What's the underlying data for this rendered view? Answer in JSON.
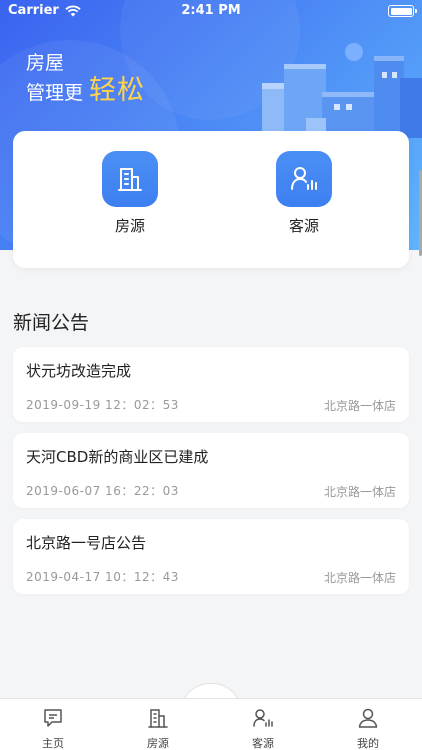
{
  "status_bar": {
    "carrier": "Carrier",
    "time": "2:41 PM"
  },
  "banner": {
    "line1": "房屋",
    "line2": "管理更",
    "accent": "轻松",
    "accent_color": "#ffd34a"
  },
  "quick_actions": [
    {
      "label": "房源",
      "icon": "building-icon"
    },
    {
      "label": "客源",
      "icon": "customer-chart-icon"
    }
  ],
  "news": {
    "title": "新闻公告",
    "items": [
      {
        "title": "状元坊改造完成",
        "time": "2019-09-19 12：02：53",
        "store": "北京路一体店"
      },
      {
        "title": "天河CBD新的商业区已建成",
        "time": "2019-06-07 16：22：03",
        "store": "北京路一体店"
      },
      {
        "title": "北京路一号店公告",
        "time": "2019-04-17 10：12：43",
        "store": "北京路一体店"
      }
    ]
  },
  "tabbar": [
    {
      "label": "主页",
      "icon": "message-icon"
    },
    {
      "label": "房源",
      "icon": "building-icon"
    },
    {
      "label": "客源",
      "icon": "customer-chart-icon"
    },
    {
      "label": "我的",
      "icon": "user-icon"
    }
  ],
  "colors": {
    "primary": "#3d7ff0",
    "accent": "#ffd34a",
    "background": "#f4f5f7"
  }
}
